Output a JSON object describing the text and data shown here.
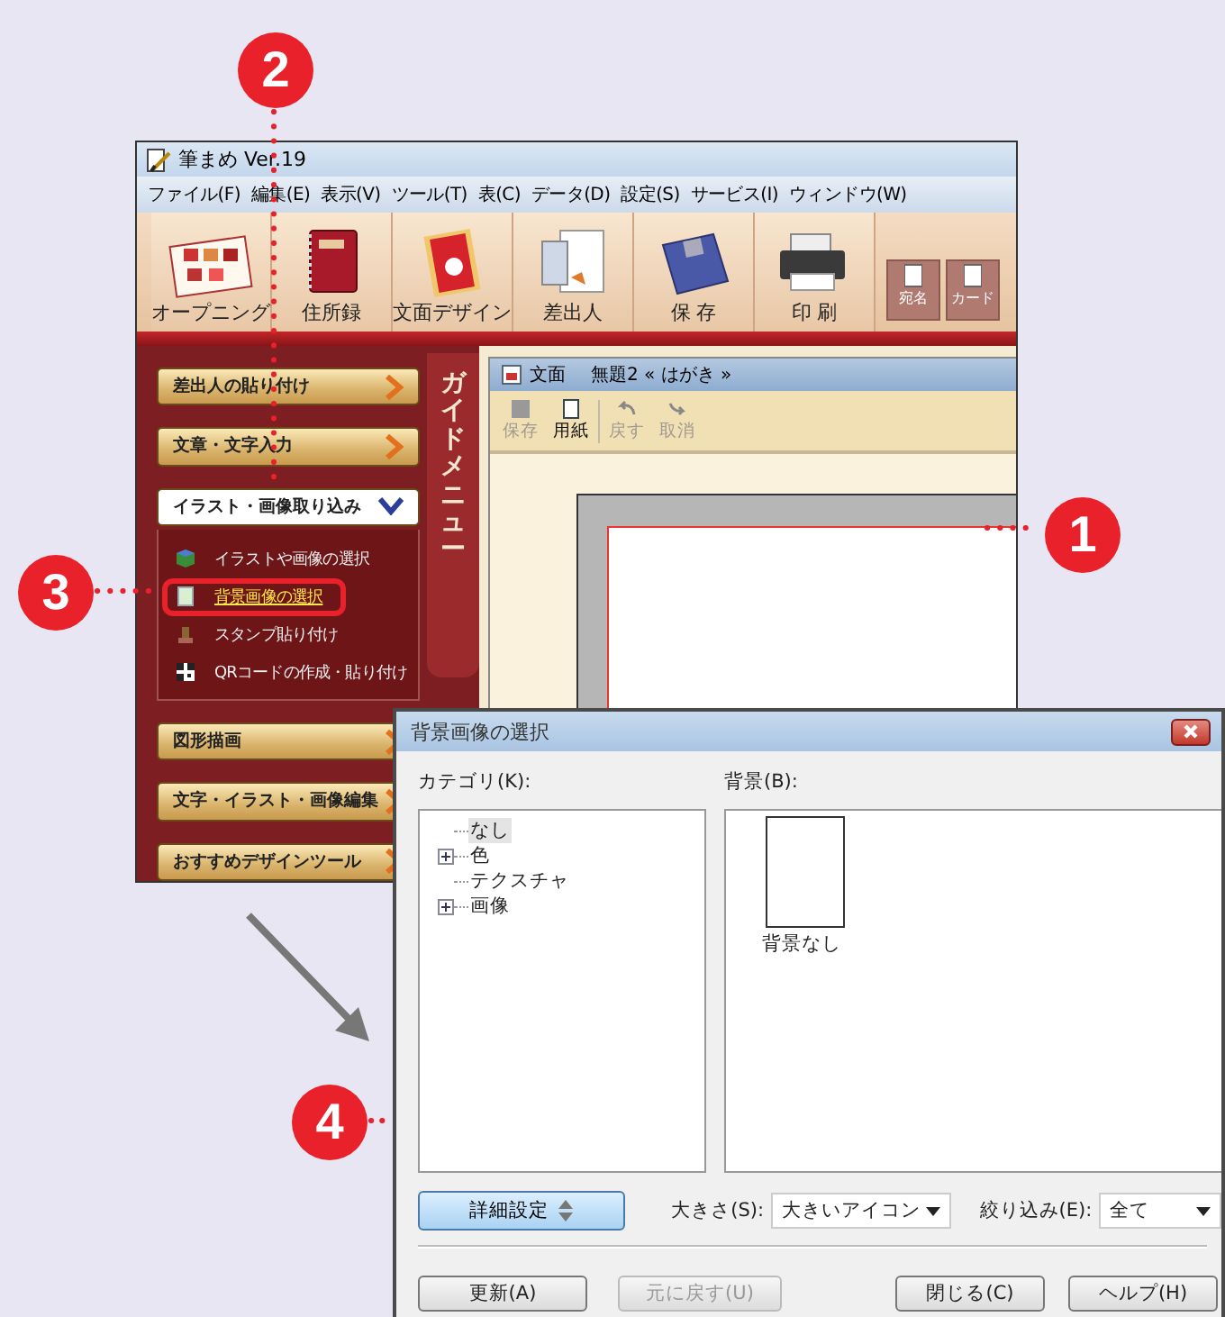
{
  "callouts": [
    {
      "label": "1"
    },
    {
      "label": "2"
    },
    {
      "label": "3"
    },
    {
      "label": "4"
    }
  ],
  "app": {
    "title": "筆まめ Ver.19",
    "menu": [
      "ファイル(F)",
      "編集(E)",
      "表示(V)",
      "ツール(T)",
      "表(C)",
      "データ(D)",
      "設定(S)",
      "サービス(I)",
      "ウィンドウ(W)"
    ],
    "toolbar": [
      {
        "label": "オープニング",
        "kind": "album"
      },
      {
        "label": "住所録",
        "kind": "book"
      },
      {
        "label": "文面デザイン",
        "kind": "card"
      },
      {
        "label": "差出人",
        "kind": "papers"
      },
      {
        "label": "保 存",
        "kind": "floppy"
      },
      {
        "label": "印 刷",
        "kind": "printer"
      }
    ],
    "small_buttons": [
      "宛名",
      "カード"
    ],
    "guide_tab": "ガイドメニュー",
    "sections": [
      {
        "label": "差出人の貼り付け",
        "expanded": false
      },
      {
        "label": "文章・文字入力",
        "expanded": false
      },
      {
        "label": "イラスト・画像取り込み",
        "expanded": true,
        "children": [
          {
            "label": "イラストや画像の選択",
            "kind": "cube",
            "selected": false
          },
          {
            "label": "背景画像の選択",
            "kind": "page",
            "selected": true
          },
          {
            "label": "スタンプ貼り付け",
            "kind": "stamp",
            "selected": false
          },
          {
            "label": "QRコードの作成・貼り付け",
            "kind": "qr",
            "selected": false
          }
        ]
      },
      {
        "label": "図形描画",
        "expanded": false
      },
      {
        "label": "文字・イラスト・画像編集",
        "expanded": false
      },
      {
        "label": "おすすめデザインツール",
        "expanded": false
      }
    ],
    "document": {
      "type": "文面",
      "title": "無題2 « はがき »",
      "tools": [
        {
          "label": "保存",
          "kind": "save",
          "disabled": true
        },
        {
          "label": "用紙",
          "kind": "paper",
          "disabled": false
        },
        {
          "label": "戻す",
          "kind": "undo",
          "disabled": true
        },
        {
          "label": "取消",
          "kind": "redo",
          "disabled": true
        }
      ]
    }
  },
  "dialog": {
    "title": "背景画像の選択",
    "category_label": "カテゴリ(K):",
    "background_label": "背景(B):",
    "tree": [
      {
        "label": "なし",
        "kind": "leaf",
        "selected": true
      },
      {
        "label": "色",
        "kind": "folder",
        "selected": false
      },
      {
        "label": "テクスチャ",
        "kind": "leaf",
        "selected": false
      },
      {
        "label": "画像",
        "kind": "folder",
        "selected": false
      }
    ],
    "backgrounds": [
      {
        "label": "背景なし"
      }
    ],
    "details_button": "詳細設定",
    "size_label": "大きさ(S):",
    "size_value": "大きいアイコン",
    "filter_label": "絞り込み(E):",
    "filter_value": "全て",
    "buttons": [
      {
        "label": "更新(A)",
        "disabled": false
      },
      {
        "label": "元に戻す(U)",
        "disabled": true
      },
      {
        "label": "閉じる(C)",
        "disabled": false
      },
      {
        "label": "ヘルプ(H)",
        "disabled": false
      }
    ]
  }
}
